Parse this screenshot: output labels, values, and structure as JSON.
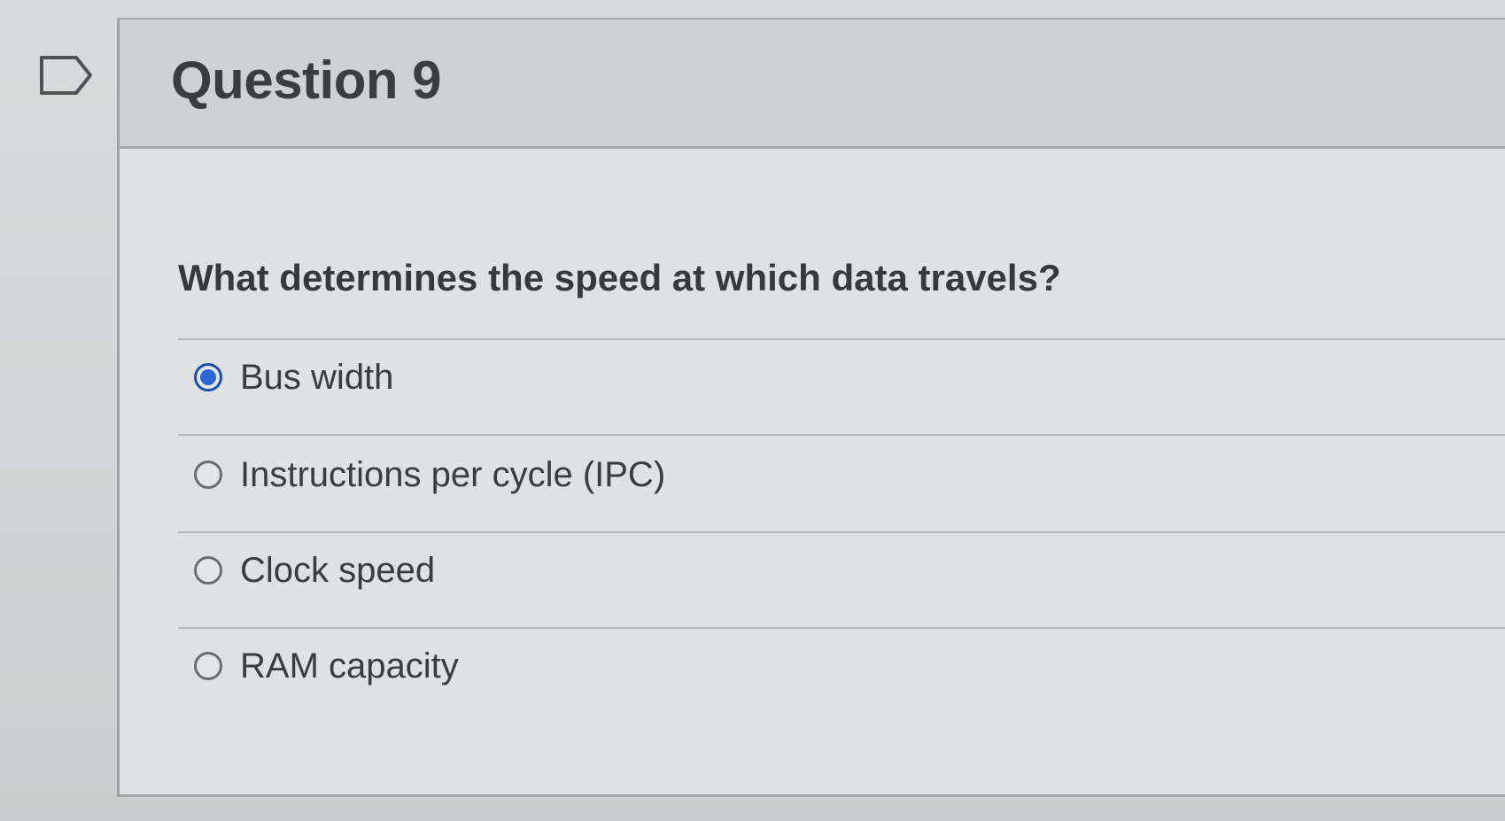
{
  "question": {
    "title": "Question 9",
    "prompt": "What determines the speed at which data travels?",
    "flag_icon": "flag-outline-icon",
    "selected_index": 0,
    "answers": [
      {
        "label": "Bus width",
        "selected": true
      },
      {
        "label": "Instructions per cycle (IPC)",
        "selected": false
      },
      {
        "label": "Clock speed",
        "selected": false
      },
      {
        "label": "RAM capacity",
        "selected": false
      }
    ]
  },
  "colors": {
    "selected_radio": "#2a66d4",
    "text": "#3a3c3f"
  }
}
